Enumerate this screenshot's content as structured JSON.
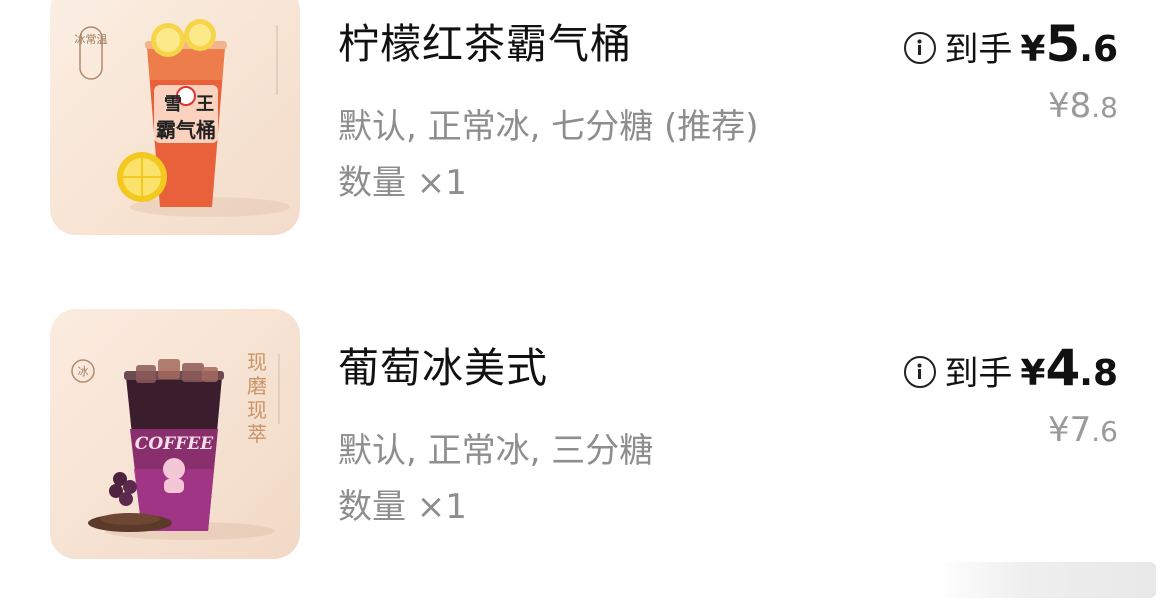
{
  "items": [
    {
      "name": "柠檬红茶霸气桶",
      "spec": "默认, 正常冰, 七分糖 (推荐)",
      "qty_label": "数量 ×1",
      "final_label": "到手",
      "currency": "¥",
      "final_int": "5",
      "final_dec": ".6",
      "orig_int": "8",
      "orig_dec": ".8",
      "badge": "冰常温",
      "cup_brand_line1": "雪王",
      "cup_brand_line2": "霸气桶"
    },
    {
      "name": "葡萄冰美式",
      "spec": "默认, 正常冰, 三分糖",
      "qty_label": "数量 ×1",
      "final_label": "到手",
      "currency": "¥",
      "final_int": "4",
      "final_dec": ".8",
      "orig_int": "7",
      "orig_dec": ".6",
      "badge": "冰",
      "side_text": "现磨现萃",
      "cup_text": "COFFEE"
    }
  ],
  "colors": {
    "text_primary": "#111111",
    "text_secondary": "#8e8e8e",
    "lemon_tea": "#e8613a",
    "grape_coffee": "#7a1f5a"
  }
}
